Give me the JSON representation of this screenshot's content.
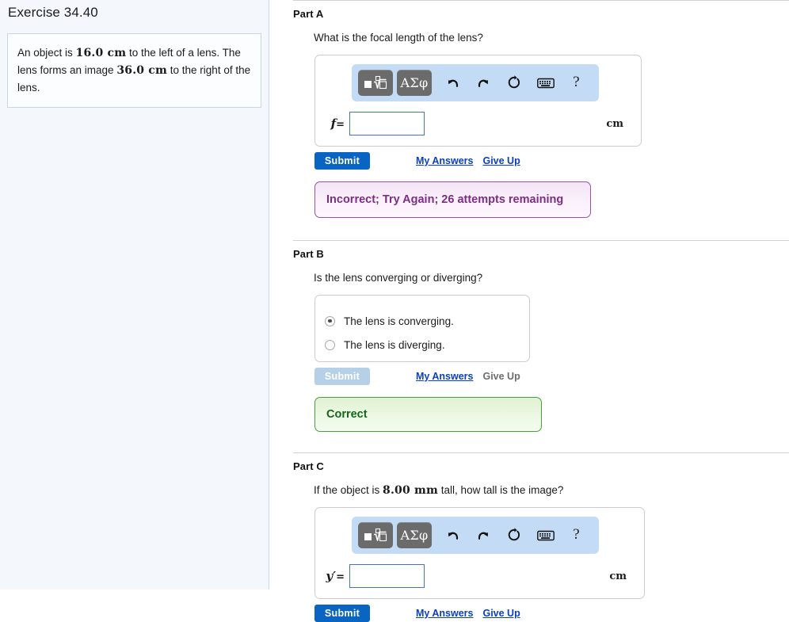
{
  "sidebar": {
    "exercise_title": "Exercise 34.40",
    "problem": {
      "s1": "An object is ",
      "v1": "16.0 cm",
      "s2": " to the left of a lens. The lens forms an image ",
      "v2": "36.0 cm",
      "s3": " to the right of the lens."
    }
  },
  "toolbar": {
    "math_icon": "math-template-icon",
    "greek_label": "ΑΣφ",
    "undo_icon": "undo-arrow-icon",
    "redo_icon": "redo-arrow-icon",
    "reset_icon": "reset-circular-arrow-icon",
    "keyboard_icon": "keyboard-icon",
    "help_label": "?"
  },
  "actions": {
    "submit_label": "Submit",
    "my_answers_label": "My Answers",
    "give_up_label": "Give Up"
  },
  "parts": {
    "a": {
      "title": "Part A",
      "question": "What is the focal length of the lens?",
      "variable": "f",
      "equals": "=",
      "value": "",
      "unit": "cm",
      "feedback": "Incorrect; Try Again; 26 attempts remaining"
    },
    "b": {
      "title": "Part B",
      "question": "Is the lens converging or diverging?",
      "choices": [
        {
          "label": "The lens is converging.",
          "selected": true
        },
        {
          "label": "The lens is diverging.",
          "selected": false
        }
      ],
      "feedback": "Correct"
    },
    "c": {
      "title": "Part C",
      "q_s1": "If the object is ",
      "q_v1": "8.00 mm",
      "q_s2": " tall, how tall is the image?",
      "variable": "y′",
      "equals": "=",
      "value": "",
      "unit": "cm"
    }
  },
  "colors": {
    "accent_blue": "#0a65c2",
    "link_blue": "#0a3fc2",
    "toolbar_blue": "#c3dbf4",
    "incorrect_purple": "#7b2f82",
    "correct_green": "#13661a",
    "sidebar_bg": "#f4f8fd"
  }
}
